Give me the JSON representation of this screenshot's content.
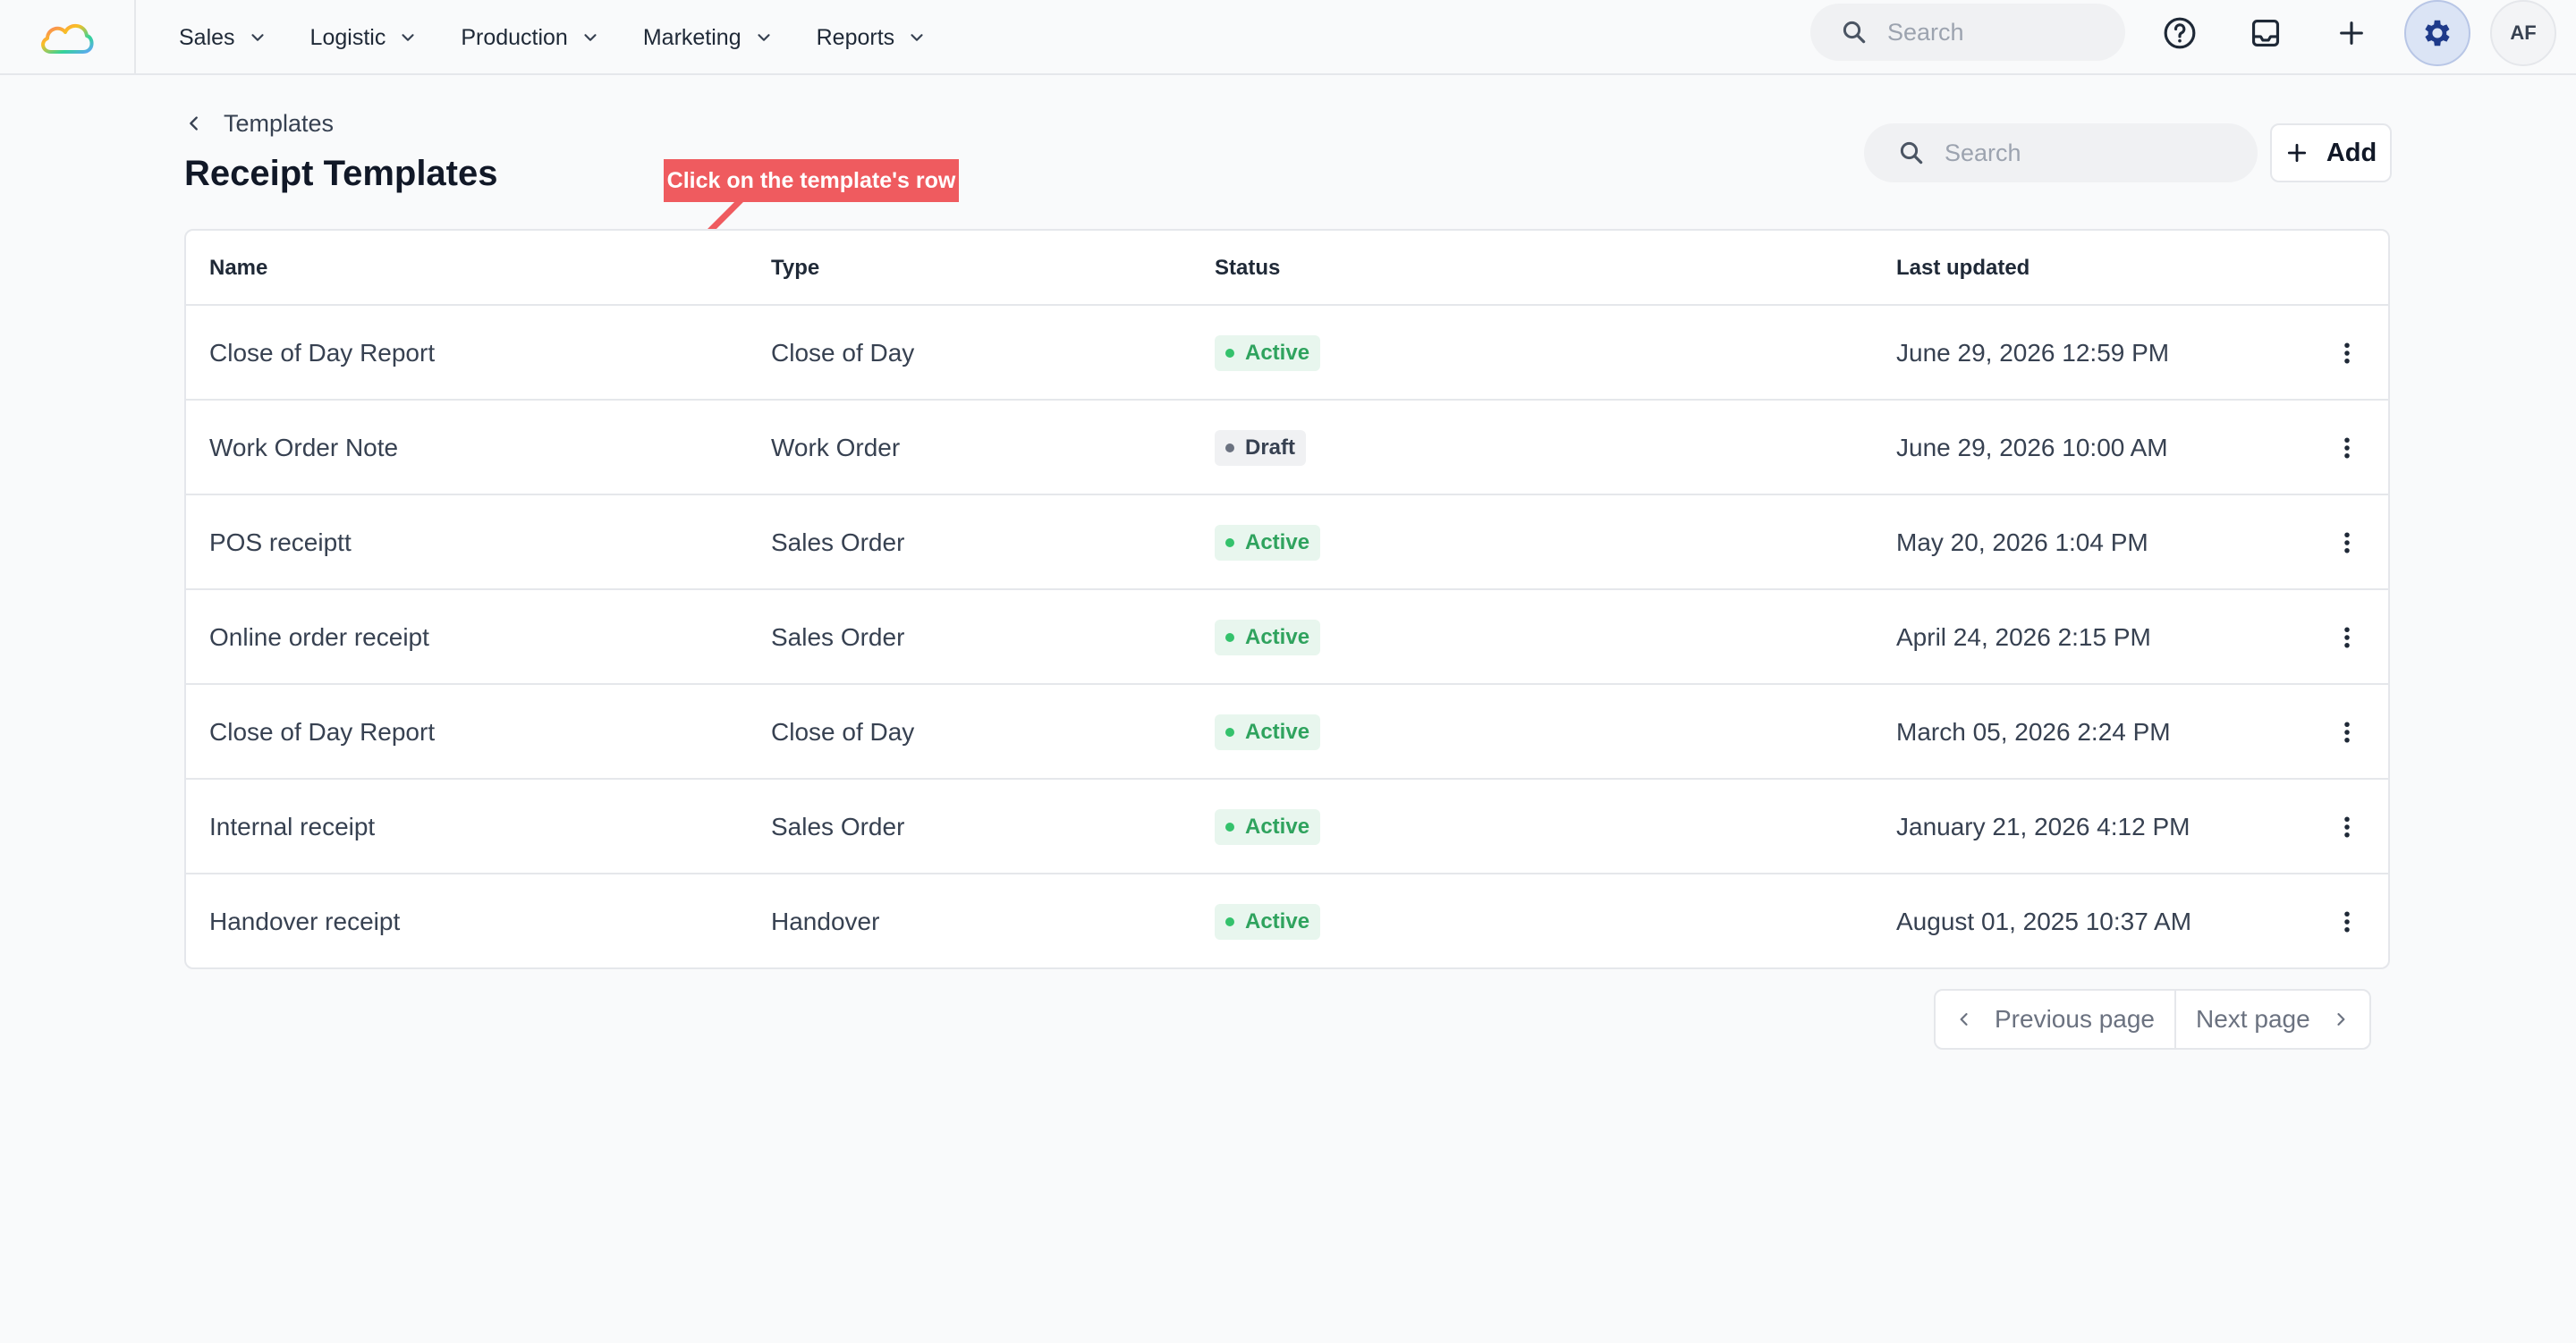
{
  "nav": {
    "items": [
      {
        "label": "Sales"
      },
      {
        "label": "Logistic"
      },
      {
        "label": "Production"
      },
      {
        "label": "Marketing"
      },
      {
        "label": "Reports"
      }
    ],
    "search_placeholder": "Search",
    "avatar_initials": "AF"
  },
  "header": {
    "breadcrumb": "Templates",
    "title": "Receipt Templates",
    "search_placeholder": "Search",
    "add_label": "Add"
  },
  "annotation": {
    "text": "Click on the template's row",
    "color": "#ef5b5f"
  },
  "table": {
    "columns": {
      "name": "Name",
      "type": "Type",
      "status": "Status",
      "updated": "Last updated"
    },
    "rows": [
      {
        "name": "Close of Day Report",
        "type": "Close of Day",
        "status": "Active",
        "updated": "June 29, 2026 12:59 PM"
      },
      {
        "name": "Work Order Note",
        "type": "Work Order",
        "status": "Draft",
        "updated": "June 29, 2026 10:00 AM"
      },
      {
        "name": "POS receiptt",
        "type": "Sales Order",
        "status": "Active",
        "updated": "May 20, 2026 1:04 PM"
      },
      {
        "name": "Online order receipt",
        "type": "Sales Order",
        "status": "Active",
        "updated": "April 24, 2026 2:15 PM"
      },
      {
        "name": "Close of Day Report",
        "type": "Close of Day",
        "status": "Active",
        "updated": "March 05, 2026 2:24 PM"
      },
      {
        "name": "Internal receipt",
        "type": "Sales Order",
        "status": "Active",
        "updated": "January 21, 2026 4:12 PM"
      },
      {
        "name": "Handover receipt",
        "type": "Handover",
        "status": "Active",
        "updated": "August 01, 2025 10:37 AM"
      }
    ]
  },
  "pagination": {
    "previous_label": "Previous page",
    "next_label": "Next page"
  },
  "colors": {
    "accent": "#1e3a8a",
    "active": "#2fa35e",
    "draft": "#6b7280"
  }
}
